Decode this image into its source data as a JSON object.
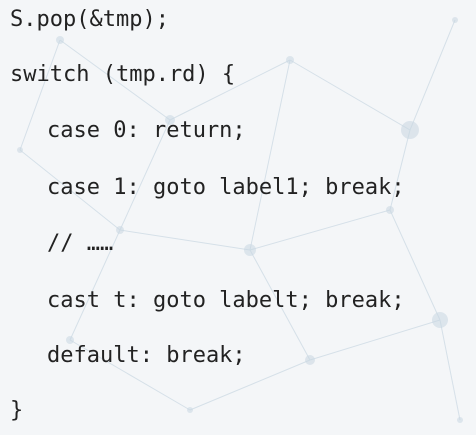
{
  "code": {
    "lines": [
      "S.pop(&tmp);",
      "switch (tmp.rd) {",
      "case 0: return;",
      "case 1: goto label1; break;",
      "// ……",
      "cast t: goto labelt; break;",
      "default: break;",
      "}"
    ]
  },
  "colors": {
    "background": "#f4f6f8",
    "text": "#222222",
    "network": "#c9d7e2"
  }
}
